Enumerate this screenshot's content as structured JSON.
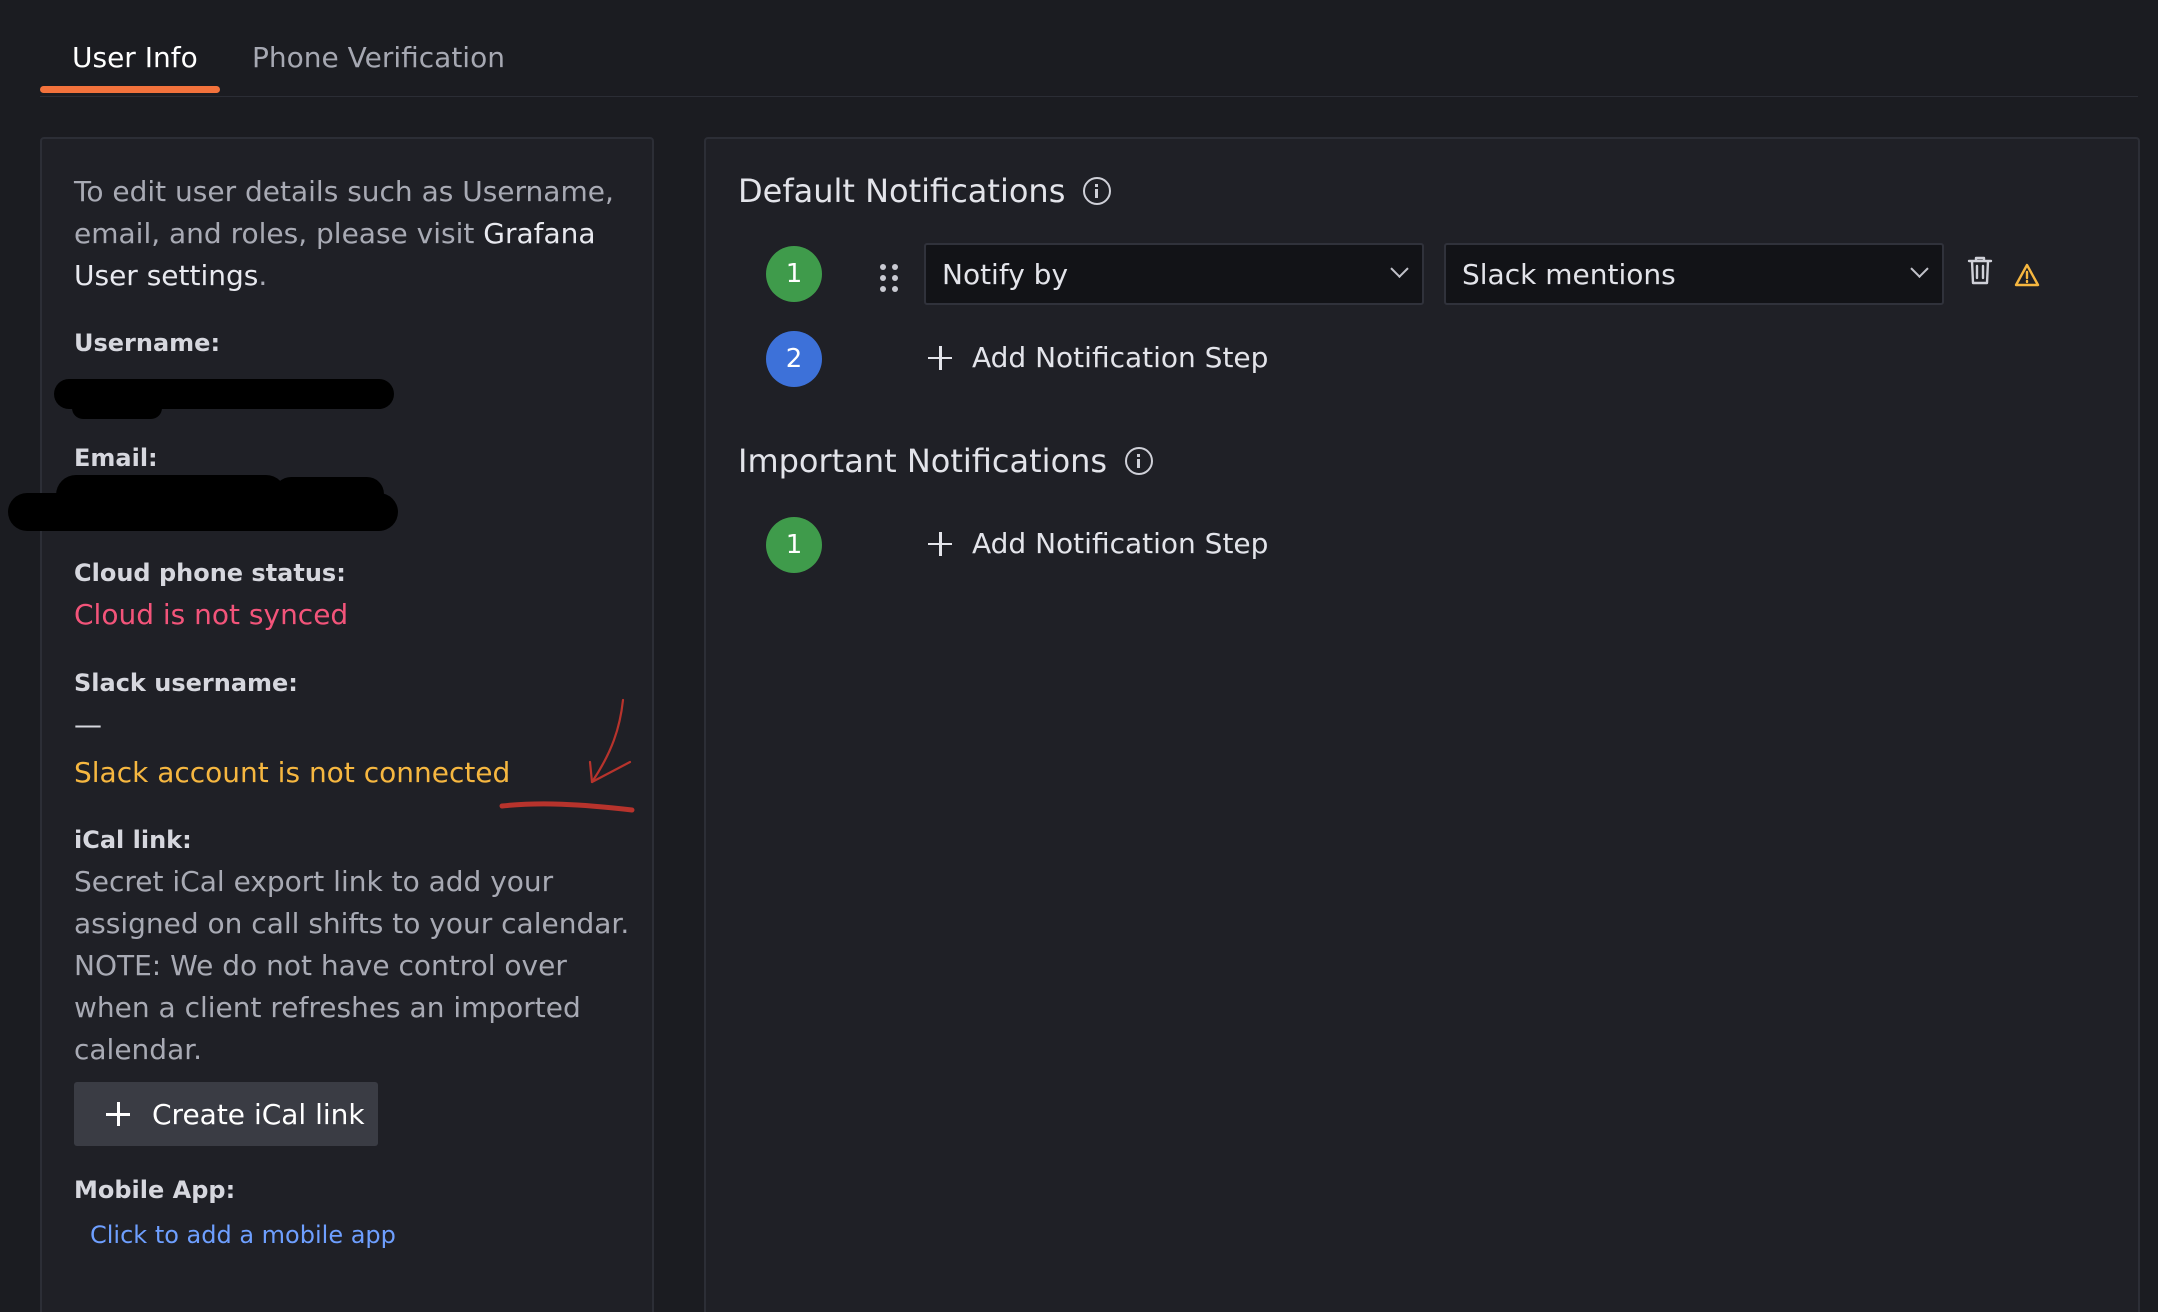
{
  "tabs": [
    {
      "label": "User Info",
      "active": true
    },
    {
      "label": "Phone Verification",
      "active": false
    }
  ],
  "user_info": {
    "intro_prefix": "To edit user details such as Username, email, and roles, please visit ",
    "intro_link": "Grafana User settings",
    "intro_suffix": ".",
    "username_label": "Username:",
    "email_label": "Email:",
    "cloud_phone_label": "Cloud phone status:",
    "cloud_phone_status": "Cloud is not synced",
    "slack_label": "Slack username:",
    "slack_value": "—",
    "slack_status": "Slack account is not connected",
    "ical_label": "iCal link:",
    "ical_description": "Secret iCal export link to add your assigned on call shifts to your calendar. NOTE: We do not have control over when a client refreshes an imported calendar.",
    "create_ical_label": "Create iCal link",
    "mobile_label": "Mobile App:",
    "mobile_link": "Click to add a mobile app"
  },
  "default_notifications": {
    "title": "Default Notifications",
    "steps": [
      {
        "number": "1",
        "type_value": "Notify by",
        "channel_value": "Slack mentions"
      },
      {
        "number": "2",
        "add_label": "Add Notification Step"
      }
    ]
  },
  "important_notifications": {
    "title": "Important Notifications",
    "steps": [
      {
        "number": "1",
        "add_label": "Add Notification Step"
      }
    ]
  },
  "colors": {
    "accent": "#f3723c",
    "error": "#f3547a",
    "warning": "#f6b740",
    "link": "#6e9fff",
    "step_green": "#3f9b4b",
    "step_blue": "#3d71d9"
  },
  "icons": [
    "info-icon",
    "drag-handle-icon",
    "chevron-down-icon",
    "trash-icon",
    "warning-icon",
    "plus-icon"
  ]
}
